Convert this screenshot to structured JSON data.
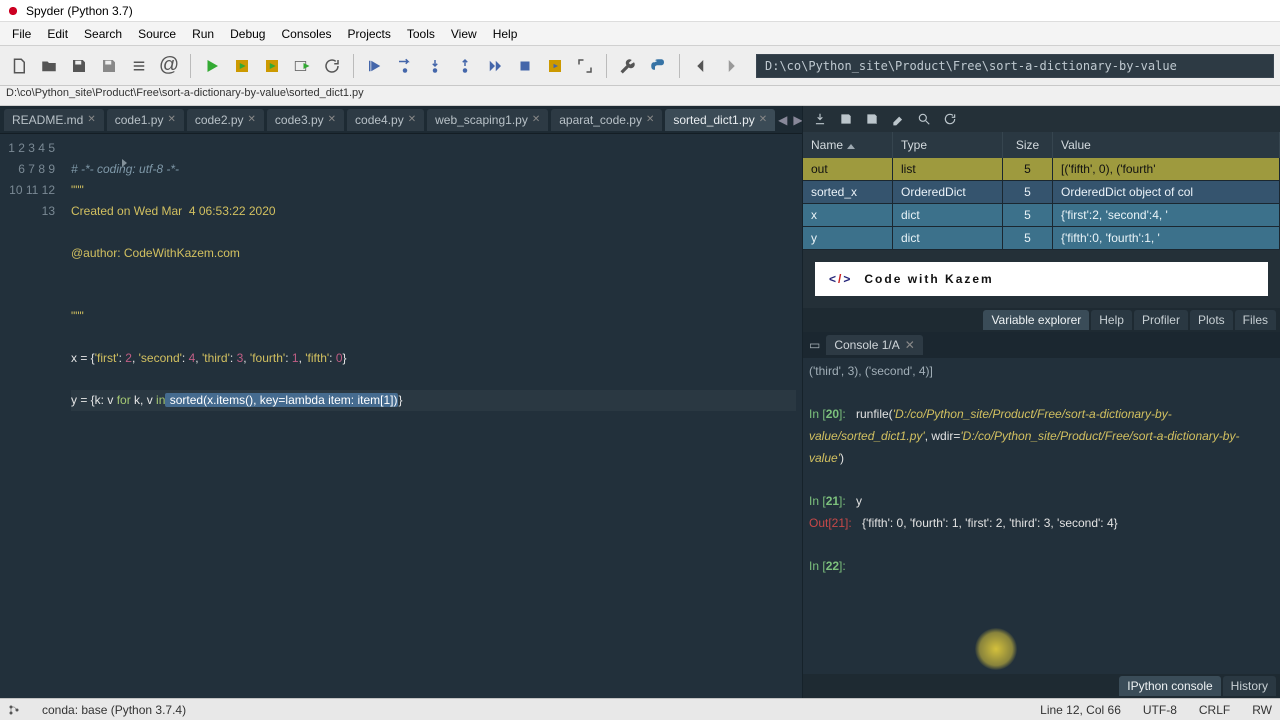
{
  "window": {
    "title": "Spyder (Python 3.7)"
  },
  "menu": [
    "File",
    "Edit",
    "Search",
    "Source",
    "Run",
    "Debug",
    "Consoles",
    "Projects",
    "Tools",
    "View",
    "Help"
  ],
  "path": "D:\\co\\Python_site\\Product\\Free\\sort-a-dictionary-by-value",
  "filepath": "D:\\co\\Python_site\\Product\\Free\\sort-a-dictionary-by-value\\sorted_dict1.py",
  "tabs": [
    "README.md",
    "code1.py",
    "code2.py",
    "code3.py",
    "code4.py",
    "web_scaping1.py",
    "aparat_code.py",
    "sorted_dict1.py"
  ],
  "active_tab": "sorted_dict1.py",
  "line_count": 13,
  "code": {
    "l1_comment": "# -*- coding: utf-8 -*-",
    "l2": "\"\"\"",
    "l3": "Created on Wed Mar  4 06:53:22 2020",
    "l5": "@author: CodeWithKazem.com",
    "l8": "\"\"\"",
    "l10_a": "x = {",
    "l10_keys": [
      "'first'",
      "'second'",
      "'third'",
      "'fourth'",
      "'fifth'"
    ],
    "l10_vals": [
      "2",
      "4",
      "3",
      "1",
      "0"
    ],
    "l12_a": "y = {k: v ",
    "l12_for": "for",
    "l12_b": " k, v ",
    "l12_in": "in",
    "l12_sorted": " sorted(x.items(), key=lambda item: item[1])",
    "l12_c": "}"
  },
  "varexp": {
    "headers": {
      "name": "Name",
      "type": "Type",
      "size": "Size",
      "value": "Value"
    },
    "rows": [
      {
        "cls": "row-out",
        "name": "out",
        "type": "list",
        "size": "5",
        "value": "[('fifth', 0), ('fourth'"
      },
      {
        "cls": "row-sx",
        "name": "sorted_x",
        "type": "OrderedDict",
        "size": "5",
        "value": "OrderedDict object of col"
      },
      {
        "cls": "row-x",
        "name": "x",
        "type": "dict",
        "size": "5",
        "value": "{'first':2, 'second':4, '"
      },
      {
        "cls": "row-y",
        "name": "y",
        "type": "dict",
        "size": "5",
        "value": "{'fifth':0, 'fourth':1, '"
      }
    ]
  },
  "panetabs": [
    "Variable explorer",
    "Help",
    "Profiler",
    "Plots",
    "Files"
  ],
  "panetab_active": "Variable explorer",
  "logo_text": "Code with Kazem",
  "console": {
    "tab": "Console 1/A",
    "body_lines": [
      {
        "t": "plain",
        "txt": "('third', 3), ('second', 4)]"
      },
      {
        "t": "blank"
      },
      {
        "t": "in",
        "n": "20",
        "cmd": "runfile(",
        "str": "'D:/co/Python_site/Product/Free/sort-a-dictionary-by-value/sorted_dict1.py'",
        "mid": ", wdir=",
        "str2": "'D:/co/Python_site/Product/Free/sort-a-dictionary-by-value'",
        "end": ")"
      },
      {
        "t": "blank"
      },
      {
        "t": "in",
        "n": "21",
        "cmd": "y"
      },
      {
        "t": "out",
        "n": "21",
        "val": "{'fifth': 0, 'fourth': 1, 'first': 2, 'third': 3, 'second': 4}"
      },
      {
        "t": "blank"
      },
      {
        "t": "in",
        "n": "22",
        "cmd": ""
      }
    ]
  },
  "bottom_tabs": [
    "IPython console",
    "History"
  ],
  "bottom_tab_active": "IPython console",
  "status": {
    "conda": "conda: base (Python 3.7.4)",
    "linecol": "Line 12, Col 66",
    "enc": "UTF-8",
    "eol": "CRLF",
    "rw": "RW"
  }
}
